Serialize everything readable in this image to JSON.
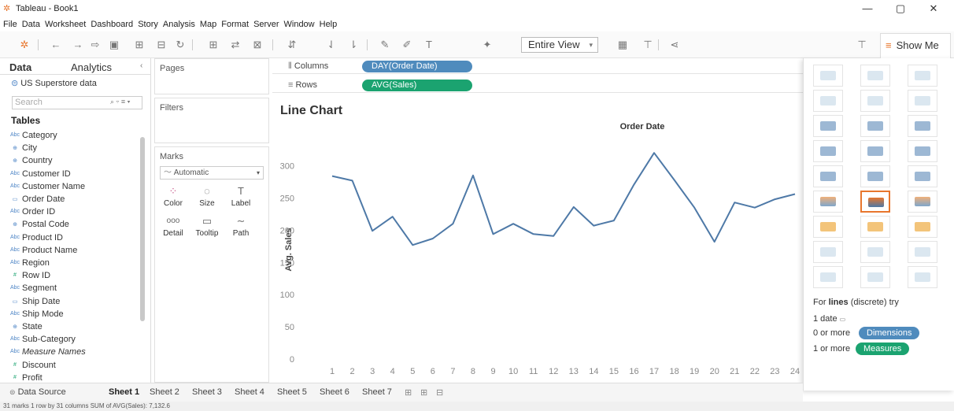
{
  "window": {
    "title": "Tableau - Book1",
    "minimize": "—",
    "restore": "▢",
    "close": "✕"
  },
  "menu": [
    "File",
    "Data",
    "Worksheet",
    "Dashboard",
    "Story",
    "Analysis",
    "Map",
    "Format",
    "Server",
    "Window",
    "Help"
  ],
  "toolbar": {
    "view_fit": "Entire View",
    "show_me": "Show Me"
  },
  "data_pane": {
    "tab_data": "Data",
    "tab_analytics": "Analytics",
    "datasource": "US Superstore data",
    "search_placeholder": "Search",
    "tables_header": "Tables",
    "fields": [
      {
        "name": "Category",
        "icon": "Abc"
      },
      {
        "name": "City",
        "icon": "⊕"
      },
      {
        "name": "Country",
        "icon": "⊕"
      },
      {
        "name": "Customer ID",
        "icon": "Abc"
      },
      {
        "name": "Customer Name",
        "icon": "Abc"
      },
      {
        "name": "Order Date",
        "icon": "▭"
      },
      {
        "name": "Order ID",
        "icon": "Abc"
      },
      {
        "name": "Postal Code",
        "icon": "⊕"
      },
      {
        "name": "Product ID",
        "icon": "Abc"
      },
      {
        "name": "Product Name",
        "icon": "Abc"
      },
      {
        "name": "Region",
        "icon": "Abc"
      },
      {
        "name": "Row ID",
        "icon": "#"
      },
      {
        "name": "Segment",
        "icon": "Abc"
      },
      {
        "name": "Ship Date",
        "icon": "▭"
      },
      {
        "name": "Ship Mode",
        "icon": "Abc"
      },
      {
        "name": "State",
        "icon": "⊕"
      },
      {
        "name": "Sub-Category",
        "icon": "Abc"
      },
      {
        "name": "Measure Names",
        "icon": "Abc"
      },
      {
        "name": "Discount",
        "icon": "#"
      },
      {
        "name": "Profit",
        "icon": "#"
      }
    ]
  },
  "shelves": {
    "pages": "Pages",
    "filters": "Filters",
    "marks": "Marks",
    "mark_type": "Automatic",
    "mark_buttons": [
      {
        "label": "Color",
        "icon": "⁘"
      },
      {
        "label": "Size",
        "icon": "◌"
      },
      {
        "label": "Label",
        "icon": "T"
      },
      {
        "label": "Detail",
        "icon": "ooo"
      },
      {
        "label": "Tooltip",
        "icon": "▭"
      },
      {
        "label": "Path",
        "icon": "~"
      }
    ],
    "columns_label": "Columns",
    "columns_pill": "DAY(Order Date)",
    "rows_label": "Rows",
    "rows_pill": "AVG(Sales)"
  },
  "chart_data": {
    "type": "line",
    "title": "Line Chart",
    "header": "Order Date",
    "ylabel": "Avg. Sales",
    "x": [
      1,
      2,
      3,
      4,
      5,
      6,
      7,
      8,
      9,
      10,
      11,
      12,
      13,
      14,
      15,
      16,
      17,
      18,
      19,
      20,
      21,
      22,
      23,
      24
    ],
    "values": [
      284,
      277,
      199,
      221,
      177,
      187,
      210,
      285,
      194,
      210,
      194,
      191,
      236,
      207,
      215,
      271,
      320,
      278,
      235,
      182,
      243,
      235,
      248,
      256
    ],
    "yticks": [
      0,
      50,
      100,
      150,
      200,
      250,
      300
    ],
    "ylim": [
      0,
      330
    ],
    "color": "#4e79a7"
  },
  "show_me": {
    "hint_prefix": "For ",
    "hint_bold": "lines",
    "hint_suffix": " (discrete) try",
    "req1": "1 date",
    "req2_prefix": "0 or more",
    "req2_pill": "Dimensions",
    "req3_prefix": "1 or more",
    "req3_pill": "Measures",
    "dim_color": "#4f8bbd",
    "meas_color": "#1ba370"
  },
  "tabs": {
    "data_source": "Data Source",
    "sheets": [
      "Sheet 1",
      "Sheet 2",
      "Sheet 3",
      "Sheet 4",
      "Sheet 5",
      "Sheet 6",
      "Sheet 7"
    ]
  },
  "status": "31 marks    1 row by 31 columns    SUM of AVG(Sales): 7,132.6"
}
